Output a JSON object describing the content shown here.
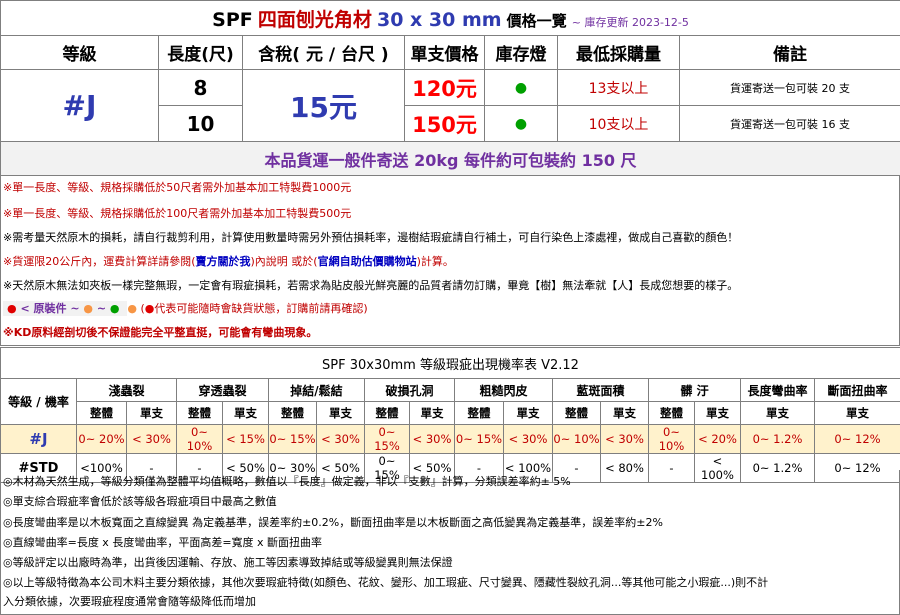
{
  "title": {
    "prefix": "SPF",
    "name": "四面刨光角材",
    "size": "30 x 30 mm",
    "suffix": "價格一覽",
    "update": "~ 庫存更新 2023-12-5"
  },
  "headers": [
    "等級",
    "長度(尺)",
    "含稅( 元 / 台尺 )",
    "單支價格",
    "庫存燈",
    "最低採購量",
    "備註"
  ],
  "grade": "#J",
  "tax_price": "15元",
  "rows": [
    {
      "length": "8",
      "unit_price": "120元",
      "stock": "●",
      "min_order": "13支以上",
      "remark": "貨運寄送一包可裝 20 支"
    },
    {
      "length": "10",
      "unit_price": "150元",
      "stock": "●",
      "min_order": "10支以上",
      "remark": "貨運寄送一包可裝 16 支"
    }
  ],
  "shipping_note": "本品貨運一般件寄送 20kg 每件約可包裝約 150 尺",
  "notes": {
    "n1": "※單一長度、等級、規格採購低於50尺者需外加基本加工特製費1000元",
    "n2": "※單一長度、等級、規格採購低於100尺者需外加基本加工特製費500元",
    "n3": "※需考量天然原木的損耗，請自行裁剪利用，計算使用數量時需另外預估損耗率，邊樹結瑕疵請自行補土，可自行染色上漆處裡，做成自己喜歡的顏色！",
    "n4a": "※貨運限20公斤內，運費計算詳請參閱(",
    "n4b": "賣方關於我",
    "n4c": ")內說明 或於(",
    "n4d": "官網自助估價購物站",
    "n4e": ")計算。",
    "n5": "※天然原木無法如夾板一樣完整無瑕，一定會有瑕疵損耗，若需求為貼皮般光鮮亮麗的品質者請勿訂購，畢竟【樹】無法牽就【人】長成您想要的樣子。",
    "n6a": "< 原裝件",
    "n6b": "~",
    "n6c": "~",
    "n6d": "(",
    "n6e": "代表可能隨時會缺貨狀態，訂購前請再確認)",
    "n7": "※KD原料經剖切後不保證能完全平整直挺，可能會有彎曲現象。"
  },
  "legend_dots": {
    "red": "●",
    "orange": "●",
    "orange2": "●",
    "green": "●",
    "red2": "●"
  },
  "defect_table": {
    "caption": "SPF 30x30mm 等級瑕疵出現機率表 V2.12",
    "corner": "等級 / 機率",
    "groups": [
      "淺蟲裂",
      "穿透蟲裂",
      "掉結/鬆結",
      "破損孔洞",
      "粗糙閃皮",
      "藍斑面積",
      "髒 汙",
      "長度彎曲率",
      "斷面扭曲率"
    ],
    "sub_whole": "整體",
    "sub_single": "單支",
    "row_j": {
      "grade": "#J",
      "cells": [
        "0~ 20%",
        "< 30%",
        "0~ 10%",
        "< 15%",
        "0~ 15%",
        "< 30%",
        "0~ 15%",
        "< 30%",
        "0~ 15%",
        "< 30%",
        "0~ 10%",
        "< 30%",
        "0~ 10%",
        "< 20%",
        "0~ 1.2%",
        "0~ 12%"
      ]
    },
    "row_std": {
      "grade": "#STD",
      "cells": [
        "<100%",
        "-",
        "-",
        "< 50%",
        "0~ 30%",
        "< 50%",
        "0~ 15%",
        "< 50%",
        "-",
        "< 100%",
        "-",
        "< 80%",
        "-",
        "< 100%",
        "0~ 1.2%",
        "0~ 12%"
      ]
    }
  },
  "method_notes": {
    "m1": "◎木材為天然生成，等級分類僅為整體平均值概略，數值以『長度』做定義，非以『支數』計算，分類誤差率約± 5%",
    "m2": "◎單支綜合瑕疵率會低於該等級各瑕疵項目中最高之數值",
    "m3": "◎長度彎曲率是以木板寬面之直線變異 為定義基準，誤差率約±0.2%，斷面扭曲率是以木板斷面之高低變異為定義基準，誤差率約±2%",
    "m4": "◎直線彎曲率=長度 x 長度彎曲率，平面高差=寬度 x 斷面扭曲率",
    "m5": "◎等級評定以出廠時為準，出貨後因運輸、存放、施工等因素導致掉結或等級變異則無法保證",
    "m6": "◎以上等級特徵為本公司木料主要分類依據，其他次要瑕疵特徵(如顏色、花紋、變形、加工瑕疵、尺寸變異、隱藏性裂紋孔洞...等其他可能之小瑕疵...)則不計",
    "m7": "入分類依據，次要瑕疵程度通常會隨等級降低而增加"
  },
  "colors": {
    "blue": "#2f3bb0",
    "red": "#ff0000",
    "darkred": "#c00000",
    "purple": "#7030a0",
    "green": "#00a000",
    "highlight": "#fff2cc"
  }
}
